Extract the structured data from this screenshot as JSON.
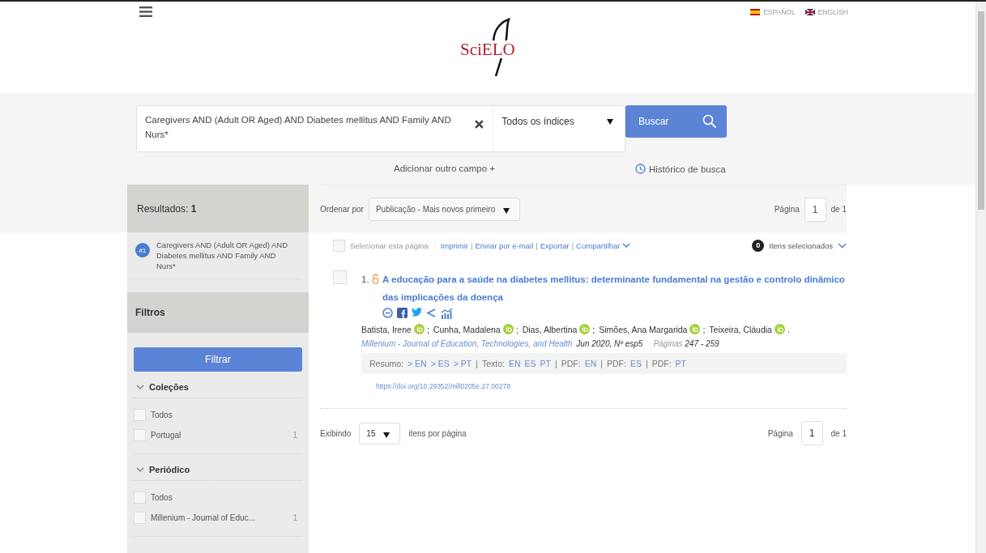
{
  "header": {
    "logo": "SciELO",
    "languages": [
      {
        "label": "ESPAÑOL",
        "kind": "es"
      },
      {
        "label": "ENGLISH",
        "kind": "gb"
      }
    ]
  },
  "search": {
    "query": "Caregivers AND (Adult OR Aged) AND Diabetes mellitus AND Family AND Nurs*",
    "index": "Todos os índices",
    "button": "Buscar",
    "add_field": "Adicionar outro campo +",
    "history": "Histórico de busca"
  },
  "sidebar": {
    "results_label": "Resultados:",
    "results_count": "1",
    "history": [
      {
        "badge": "#1",
        "query": "Caregivers AND (Adult OR Aged) AND Diabetes mellitus AND Family AND Nurs*"
      }
    ],
    "filters_title": "Filtros",
    "filter_button": "Filtrar",
    "groups": [
      {
        "title": "Coleções",
        "expanded": true,
        "options": [
          {
            "label": "Todos",
            "checked": false
          },
          {
            "label": "Portugal",
            "count": "1",
            "checked": false
          }
        ]
      },
      {
        "title": "Periódico",
        "expanded": true,
        "options": [
          {
            "label": "Todos",
            "checked": false
          },
          {
            "label": "Millenium - Journal of Educ...",
            "count": "1",
            "checked": false
          }
        ]
      }
    ]
  },
  "toolbar": {
    "sort_label": "Ordenar por",
    "sort_value": "Publicação - Mais novos primeiro",
    "page_label": "Página",
    "page": "1",
    "page_total": "de 1"
  },
  "actions": {
    "select_page": "Selecionar esta página",
    "select_checked": false,
    "links": [
      {
        "label": "Imprimir",
        "separator": "|"
      },
      {
        "label": "Enviar por e-mail",
        "separator": "|"
      },
      {
        "label": "Exportar",
        "separator": "|"
      },
      {
        "label": "Compartilhar"
      }
    ],
    "selected_count": "0",
    "selected_label": "Itens selecionados"
  },
  "results": [
    {
      "number": "1.",
      "checked": false,
      "title": "A educação para a saúde na diabetes mellitus: determinante fundamental na gestão e controlo dinâmico das implicações da doença",
      "authors": [
        {
          "name": "Batista, Irene",
          "punctuation": ";"
        },
        {
          "name": "Cunha, Madalena",
          "punctuation": ";"
        },
        {
          "name": "Dias, Albertina",
          "punctuation": ";"
        },
        {
          "name": "Simões, Ana Margarida",
          "punctuation": ";"
        },
        {
          "name": "Teixeira, Cláudia",
          "punctuation": "."
        }
      ],
      "journal": "Millenium - Journal of Education, Technologies, and Health",
      "issue": "Jun 2020, Nº esp5",
      "pages_label": "Páginas",
      "pages": "247 - 259",
      "links": [
        {
          "label": "Resumo:",
          "langs": [
            "> EN",
            "> ES",
            "> PT"
          ]
        },
        {
          "separator": "|",
          "label": "Texto:",
          "langs": [
            "EN",
            "ES",
            "PT"
          ]
        },
        {
          "separator": "|",
          "label": "PDF:",
          "langs": [
            "EN"
          ]
        },
        {
          "separator": "|",
          "label": "PDF:",
          "langs": [
            "ES"
          ]
        },
        {
          "separator": "|",
          "label": "PDF:",
          "langs": [
            "PT"
          ]
        }
      ],
      "doi": "https://doi.org/10.29352/mill0205e.27.00278"
    }
  ],
  "footer": {
    "showing_label": "Exibindo",
    "per_page": "15",
    "per_page_label": "itens por página",
    "page_label": "Página",
    "page": "1",
    "page_total": "de 1"
  }
}
